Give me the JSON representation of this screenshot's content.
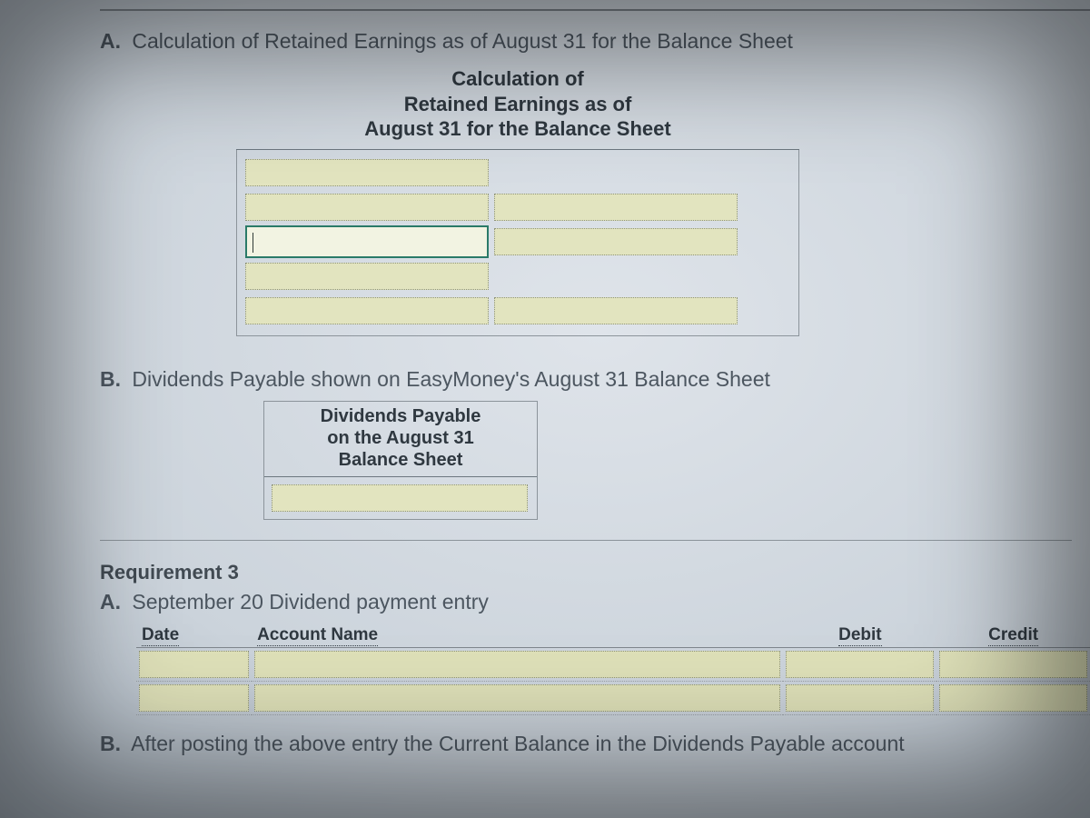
{
  "sectionA": {
    "marker": "A.",
    "prompt": "Calculation of Retained Earnings as of August 31 for the Balance Sheet",
    "boxTitle": {
      "line1": "Calculation of",
      "line2": "Retained Earnings as of",
      "line3": "August 31 for the Balance Sheet"
    }
  },
  "sectionB": {
    "marker": "B.",
    "prompt": "Dividends Payable shown on EasyMoney's August 31 Balance Sheet",
    "boxTitle": {
      "line1": "Dividends Payable",
      "line2": "on the August 31",
      "line3": "Balance Sheet"
    }
  },
  "req3": {
    "heading": "Requirement 3",
    "partA": {
      "marker": "A.",
      "prompt": "September 20 Dividend payment entry",
      "columns": {
        "date": "Date",
        "account": "Account Name",
        "debit": "Debit",
        "credit": "Credit"
      }
    },
    "partB": {
      "marker": "B.",
      "prompt": "After posting the above entry the Current Balance in the Dividends Payable account"
    }
  }
}
